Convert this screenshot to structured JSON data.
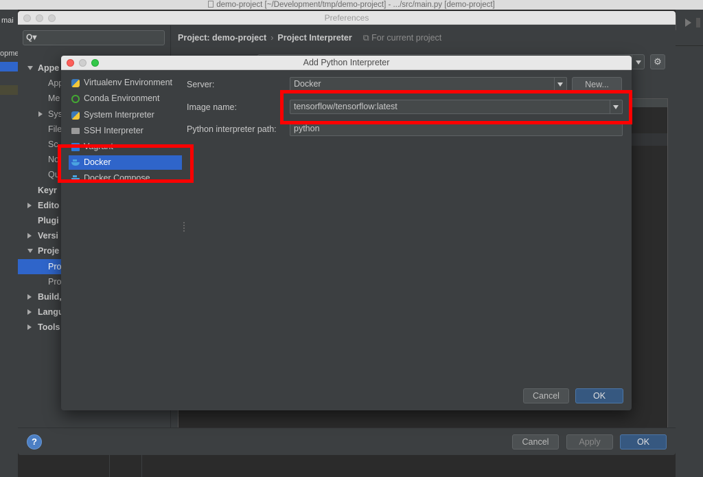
{
  "ide": {
    "title": "demo-project [~/Development/tmp/demo-project] - .../src/main.py [demo-project]",
    "left_tab_main": "mai",
    "left_tab_project": "opme"
  },
  "preferences": {
    "title": "Preferences",
    "search_placeholder": "",
    "tree": [
      {
        "label": "Appe",
        "arrow": "down",
        "bold": true
      },
      {
        "label": "App",
        "indent": 2
      },
      {
        "label": "Me",
        "indent": 2
      },
      {
        "label": "Sys",
        "indent": 2,
        "arrow": "right"
      },
      {
        "label": "File",
        "indent": 2
      },
      {
        "label": "Sc",
        "indent": 2
      },
      {
        "label": "No",
        "indent": 2
      },
      {
        "label": "Qu",
        "indent": 2
      },
      {
        "label": "Keyr",
        "bold": true
      },
      {
        "label": "Edito",
        "arrow": "right",
        "bold": true
      },
      {
        "label": "Plugi",
        "bold": true
      },
      {
        "label": "Versi",
        "arrow": "right",
        "bold": true
      },
      {
        "label": "Proje",
        "arrow": "down",
        "bold": true
      },
      {
        "label": "Pro",
        "indent": 2,
        "selected": true
      },
      {
        "label": "Pro",
        "indent": 2
      },
      {
        "label": "Build,",
        "arrow": "right",
        "bold": true
      },
      {
        "label": "Langu",
        "arrow": "right",
        "bold": true
      },
      {
        "label": "Tools",
        "arrow": "right",
        "bold": true
      }
    ],
    "breadcrumb": {
      "project": "Project: demo-project",
      "separator": "›",
      "page": "Project Interpreter",
      "scope": "For current project"
    },
    "footer": {
      "help": "?",
      "cancel": "Cancel",
      "apply": "Apply",
      "ok": "OK"
    }
  },
  "dialog": {
    "title": "Add Python Interpreter",
    "environments": [
      {
        "label": "Virtualenv Environment",
        "icon": "python-icon"
      },
      {
        "label": "Conda Environment",
        "icon": "conda-icon"
      },
      {
        "label": "System Interpreter",
        "icon": "python-icon"
      },
      {
        "label": "SSH Interpreter",
        "icon": "ssh-icon"
      },
      {
        "label": "Vagrant",
        "icon": "vagrant-icon"
      },
      {
        "label": "Docker",
        "icon": "docker-icon",
        "selected": true
      },
      {
        "label": "Docker Compose",
        "icon": "docker-compose-icon"
      }
    ],
    "form": {
      "server_label": "Server:",
      "server_value": "Docker",
      "new_button": "New...",
      "image_label": "Image name:",
      "image_value": "tensorflow/tensorflow:latest",
      "path_label": "Python interpreter path:",
      "path_value": "python"
    },
    "cancel": "Cancel",
    "ok": "OK"
  },
  "colors": {
    "highlight": "#ff0000",
    "selection": "#2f65ca",
    "primary_button": "#365880"
  }
}
